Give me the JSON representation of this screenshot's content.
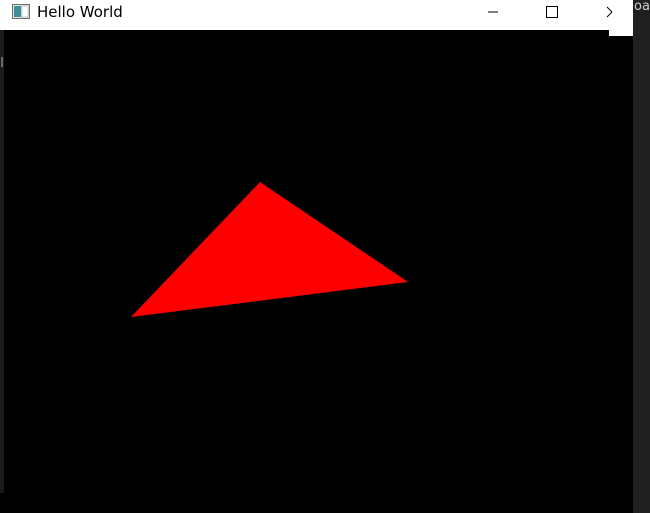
{
  "window": {
    "title": "Hello World",
    "caption_buttons": {
      "minimize": "minimize-icon",
      "maximize": "maximize-icon",
      "close": "close-icon"
    }
  },
  "background_window": {
    "edge_text": "oad"
  },
  "scene": {
    "background_color": "#000000",
    "triangle_color": "#ff0000"
  }
}
